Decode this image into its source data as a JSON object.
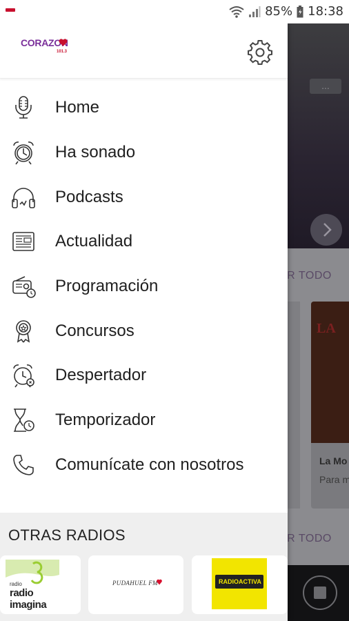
{
  "status_bar": {
    "battery": "85%",
    "time": "18:38"
  },
  "drawer": {
    "logo": {
      "name": "CORAZON",
      "frequency": "101.3"
    },
    "menu": [
      {
        "label": "Home",
        "icon": "microphone-icon"
      },
      {
        "label": "Ha sonado",
        "icon": "alarm-clock-icon"
      },
      {
        "label": "Podcasts",
        "icon": "headphones-icon"
      },
      {
        "label": " Actualidad",
        "icon": "newspaper-icon"
      },
      {
        "label": "Programación",
        "icon": "radio-schedule-icon"
      },
      {
        "label": "Concursos",
        "icon": "award-icon"
      },
      {
        "label": "Despertador",
        "icon": "alarm-clock-icon"
      },
      {
        "label": "Temporizador",
        "icon": "hourglass-timer-icon"
      },
      {
        "label": "Comunícate con nosotros",
        "icon": "phone-icon"
      }
    ],
    "other_radios": {
      "title": "OTRAS RADIOS",
      "stations": [
        {
          "name": "radio imagina"
        },
        {
          "name": "PUDAHUEL FM"
        },
        {
          "name": "RADIOACTIVA"
        }
      ]
    }
  },
  "background": {
    "see_all_1": "ER TODO",
    "see_all_2": "ER TODO",
    "card_title": "La Mo",
    "card_subtitle": "Para m",
    "card_image_text": "LA",
    "dots": "..."
  },
  "colors": {
    "brand_purple": "#7a2f9a",
    "brand_red": "#c8102e",
    "radioactiva_yellow": "#f2e500"
  }
}
